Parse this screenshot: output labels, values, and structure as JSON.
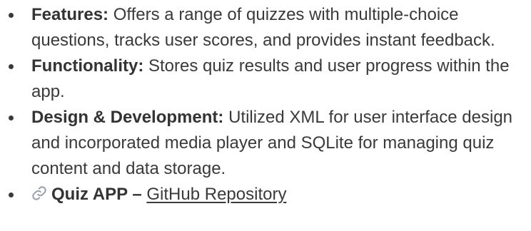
{
  "items": [
    {
      "label": "Features:",
      "text": "Offers a range of quizzes with multiple-choice questions, tracks user scores, and provides instant feedback."
    },
    {
      "label": "Functionality:",
      "text": "Stores quiz results and user progress within the app."
    },
    {
      "label": "Design & Development:",
      "text": "Utilized XML for user interface design and incorporated media player and SQLite for managing quiz content and data storage."
    }
  ],
  "project_link": {
    "icon": "link-icon",
    "title": "Quiz APP –",
    "link_text": "GitHub Repository"
  },
  "colors": {
    "text": "#3a3a3a",
    "icon": "#9aa0aa"
  }
}
